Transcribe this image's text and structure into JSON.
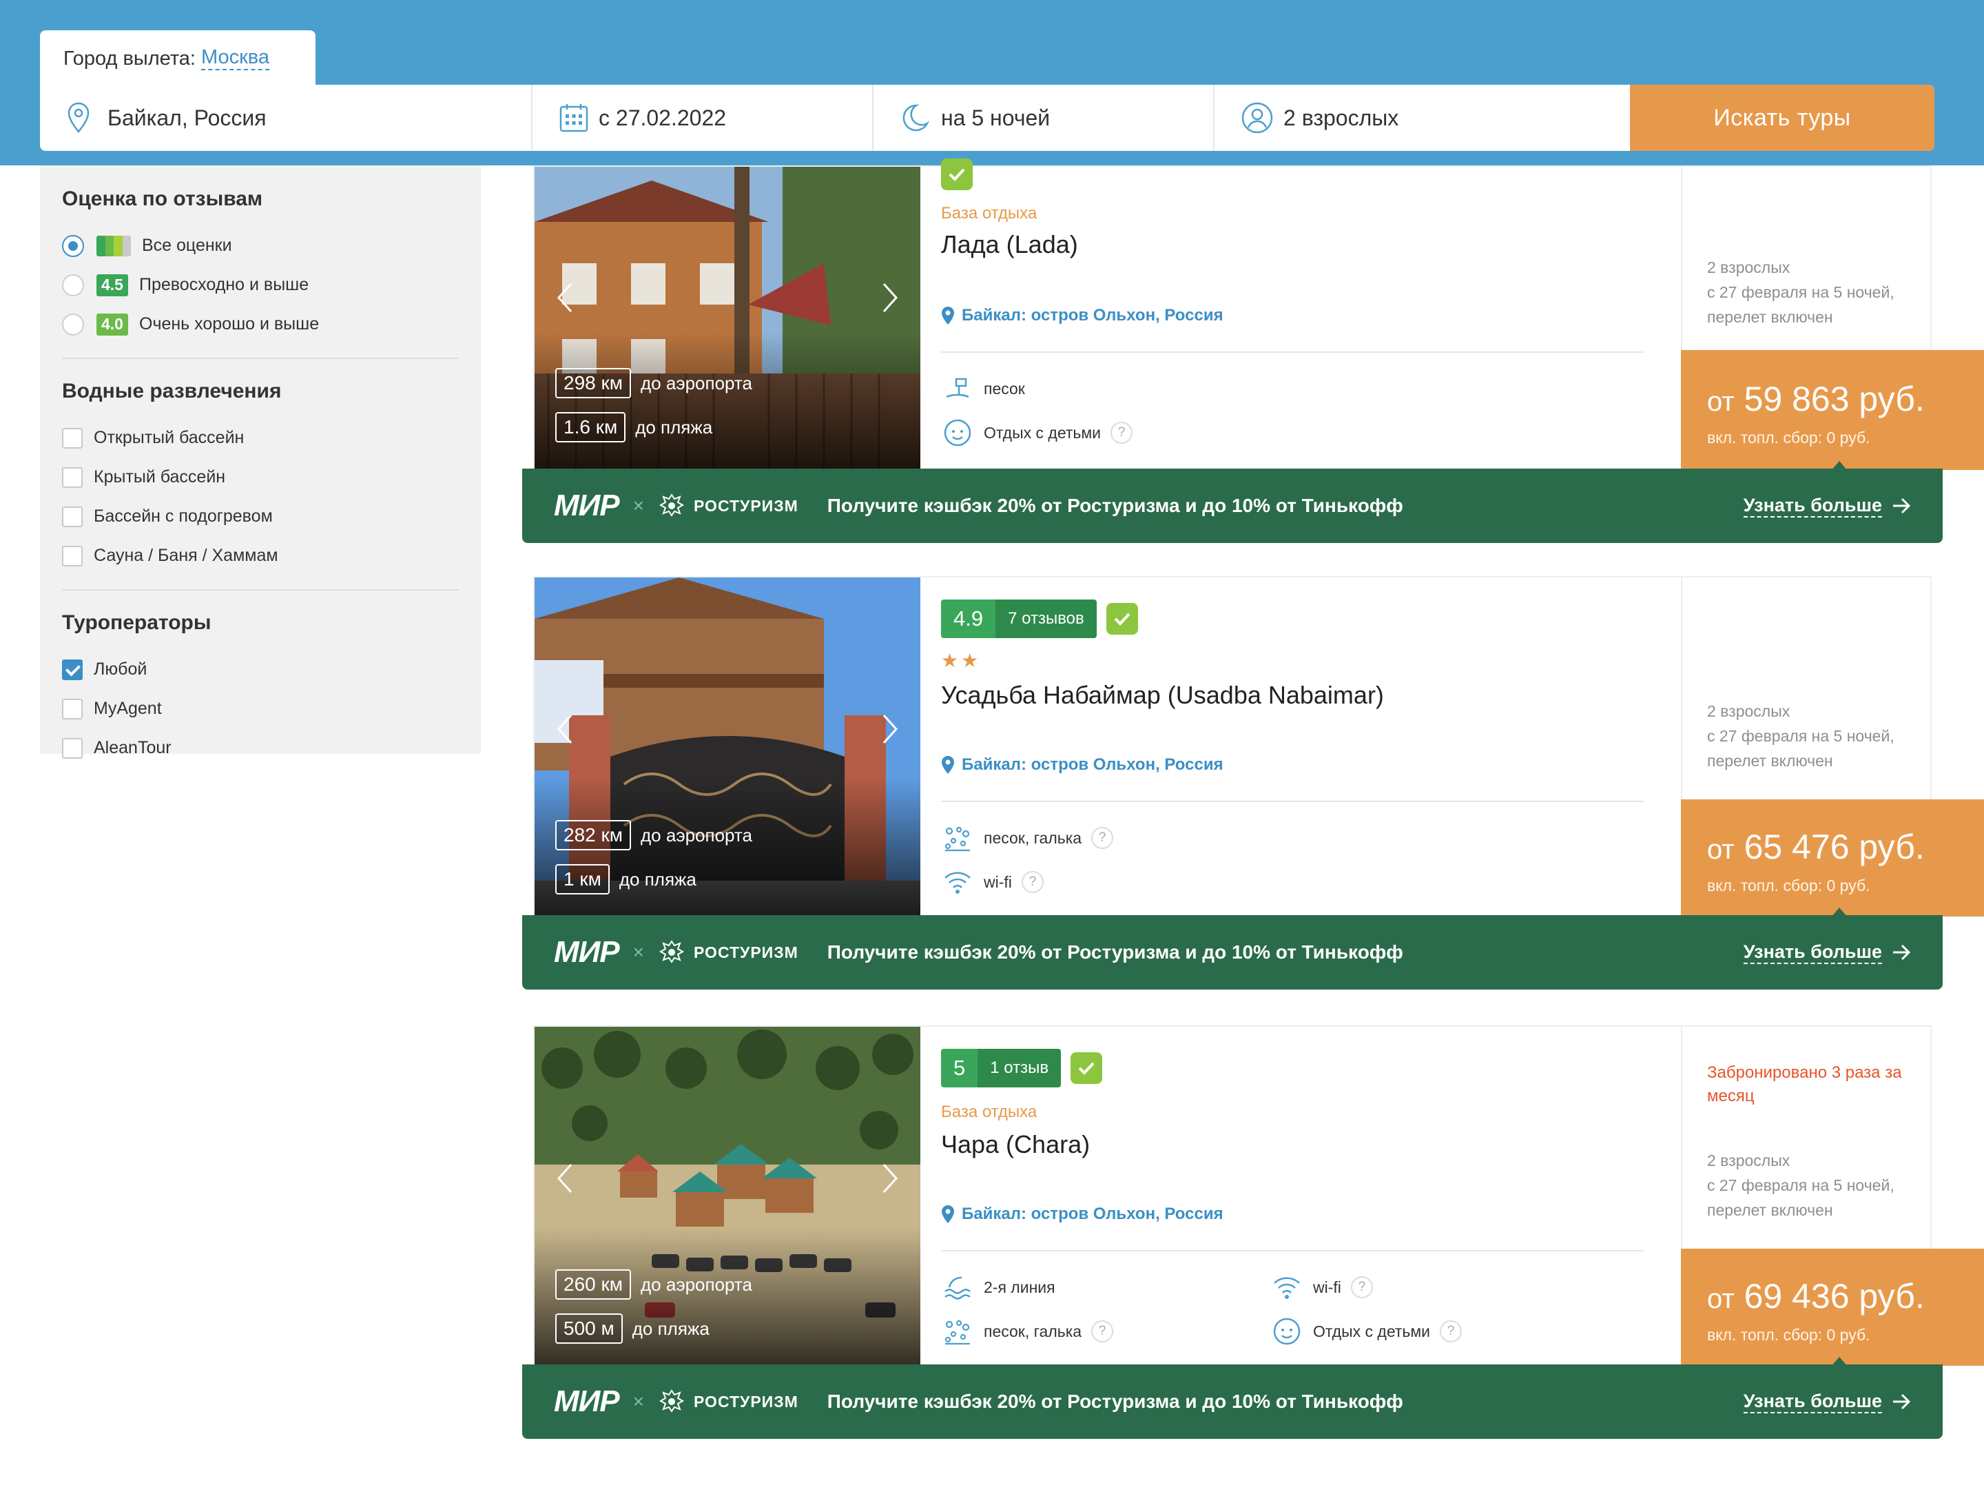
{
  "header": {
    "city_label": "Город вылета:",
    "city_value": "Москва",
    "destination": "Байкал, Россия",
    "date": "с 27.02.2022",
    "nights": "на 5 ночей",
    "adults": "2 взрослых",
    "search_button": "Искать туры"
  },
  "sidebar": {
    "rating_title": "Оценка по отзывам",
    "rating_options": [
      {
        "label": "Все оценки",
        "badge": "",
        "selected": true
      },
      {
        "label": "Превосходно и выше",
        "badge": "4.5",
        "selected": false
      },
      {
        "label": "Очень хорошо и выше",
        "badge": "4.0",
        "selected": false
      }
    ],
    "water_title": "Водные развлечения",
    "water_options": [
      "Открытый бассейн",
      "Крытый бассейн",
      "Бассейн с подогревом",
      "Сауна / Баня / Хаммам"
    ],
    "operators_title": "Туроператоры",
    "operators": [
      {
        "label": "Любой",
        "checked": true
      },
      {
        "label": "MyAgent",
        "checked": false
      },
      {
        "label": "AleanTour",
        "checked": false
      }
    ]
  },
  "promo": {
    "mir": "МИР",
    "x": "×",
    "rosturizm": "РОСТУРИЗМ",
    "text": "Получите кэшбэк 20% от Ростуризма и до 10% от Тинькофф",
    "link": "Узнать больше"
  },
  "hotels": [
    {
      "type": "База отдыха",
      "name": "Лада (Lada)",
      "location": "Байкал: остров Ольхон, Россия",
      "airport_dist": "298 км",
      "airport_label": "до аэропорта",
      "beach_dist": "1.6 км",
      "beach_label": "до пляжа",
      "features": [
        "песок",
        "Отдых с детьми"
      ],
      "price_info": [
        "2 взрослых",
        "с 27 февраля на 5 ночей,",
        "перелет включен"
      ],
      "price_prefix": "от",
      "price": "59 863 руб.",
      "fee": "вкл. топл. сбор: 0 руб."
    },
    {
      "score": "4.9",
      "reviews": "7 отзывов",
      "stars": "★★",
      "star_count": 2,
      "name": "Усадьба Набаймар (Usadba Nabaimar)",
      "location": "Байкал: остров Ольхон, Россия",
      "airport_dist": "282 км",
      "airport_label": "до аэропорта",
      "beach_dist": "1 км",
      "beach_label": "до пляжа",
      "features": [
        "песок, галька",
        "wi-fi"
      ],
      "price_info": [
        "2 взрослых",
        "с 27 февраля на 5 ночей,",
        "перелет включен"
      ],
      "price_prefix": "от",
      "price": "65 476 руб.",
      "fee": "вкл. топл. сбор: 0 руб."
    },
    {
      "score": "5",
      "reviews": "1 отзыв",
      "type": "База отдыха",
      "name": "Чара (Chara)",
      "location": "Байкал: остров Ольхон, Россия",
      "airport_dist": "260 км",
      "airport_label": "до аэропорта",
      "beach_dist": "500 м",
      "beach_label": "до пляжа",
      "features": [
        "2-я линия",
        "песок, галька",
        "wi-fi",
        "Отдых с детьми"
      ],
      "booked": "Забронировано 3 раза за месяц",
      "price_info": [
        "2 взрослых",
        "с 27 февраля на 5 ночей,",
        "перелет включен"
      ],
      "price_prefix": "от",
      "price": "69 436 руб.",
      "fee": "вкл. топл. сбор: 0 руб."
    }
  ],
  "colors": {
    "header_blue": "#4a9fcf",
    "accent_orange": "#e7994b",
    "promo_green": "#2a6b4b",
    "rating_green": "#3aa65a",
    "link_blue": "#3b8fc6",
    "booked_red": "#e8542a"
  }
}
